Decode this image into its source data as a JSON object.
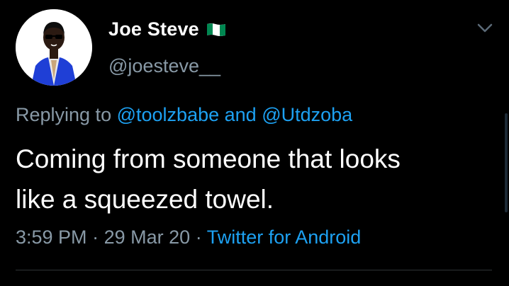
{
  "tweet": {
    "author": {
      "display_name": "Joe Steve",
      "handle": "@joesteve__",
      "avatar_icon": "cartoon-avatar-icon",
      "flag_icon": "nigeria-flag-icon"
    },
    "reply": {
      "prefix": "Replying to",
      "mention_1": "@toolzbabe",
      "conjunction": "and",
      "mention_2": "@Utdzoba"
    },
    "text_line_1": "Coming from someone that looks",
    "text_line_2": "like a squeezed towel.",
    "meta": {
      "time": "3:59 PM",
      "separator": "·",
      "date": "29 Mar 20",
      "source": "Twitter for Android"
    },
    "menu_icon": "chevron-down-icon"
  },
  "colors": {
    "background": "#000000",
    "primary_text": "#ffffff",
    "secondary_text": "#8899a6",
    "accent": "#1da1f2",
    "flag_green": "#008751"
  }
}
